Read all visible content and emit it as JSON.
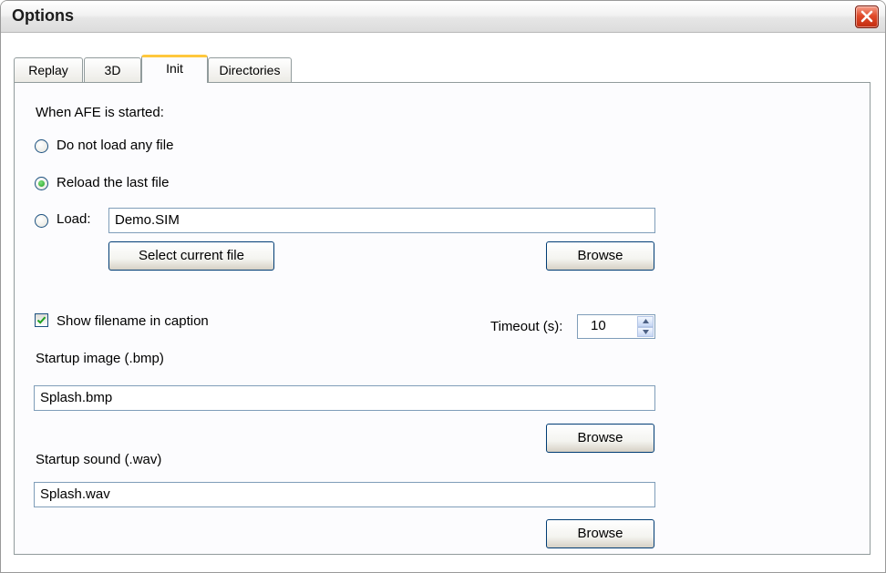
{
  "window": {
    "title": "Options"
  },
  "tabs": [
    {
      "label": "Replay",
      "active": false
    },
    {
      "label": "3D",
      "active": false
    },
    {
      "label": "Init",
      "active": true
    },
    {
      "label": "Directories",
      "active": false
    }
  ],
  "init": {
    "startup_heading": "When AFE is started:",
    "radio_no_load": "Do not load any file",
    "radio_reload_last": "Reload the last file",
    "radio_load": "Load:",
    "load_file_value": "Demo.SIM",
    "select_current_label": "Select current file",
    "browse_label": "Browse",
    "show_filename_label": "Show filename in caption",
    "show_filename_checked": true,
    "timeout_label": "Timeout (s):",
    "timeout_value": "10",
    "startup_image_label": "Startup image (.bmp)",
    "startup_image_value": "Splash.bmp",
    "startup_sound_label": "Startup sound (.wav)",
    "startup_sound_value": "Splash.wav"
  },
  "icons": {
    "close": "close-icon",
    "check": "checkmark-icon",
    "spin_up": "arrow-up-icon",
    "spin_down": "arrow-down-icon"
  },
  "colors": {
    "close_button": "#d83c1c",
    "selection_accent": "#21a121",
    "tab_highlight": "#ffc83c"
  }
}
